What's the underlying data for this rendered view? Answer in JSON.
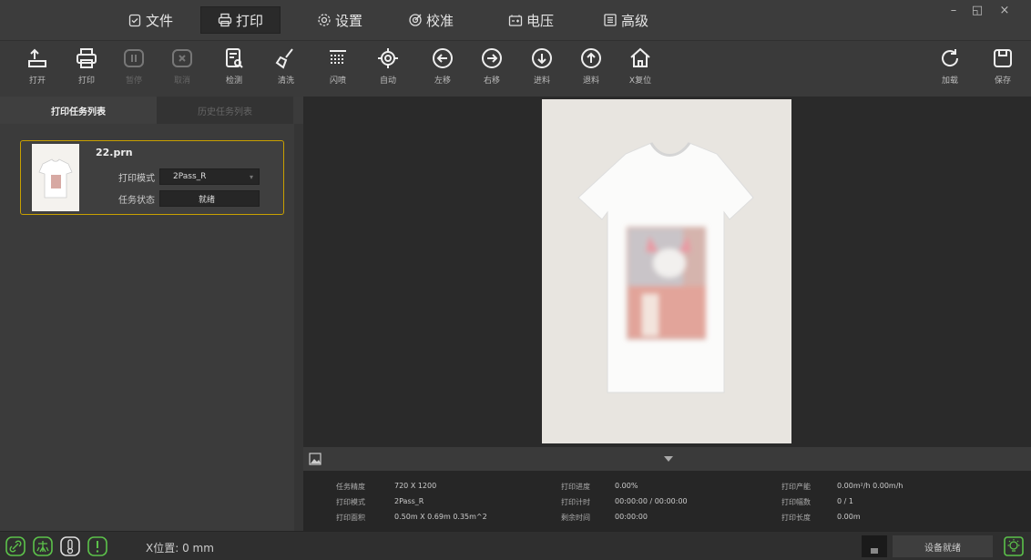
{
  "menu": {
    "file": "文件",
    "print": "打印",
    "settings": "设置",
    "calibrate": "校准",
    "voltage": "电压",
    "advanced": "高级"
  },
  "window": {
    "minimize": "–",
    "restore": "◱",
    "close": "×"
  },
  "toolbar": {
    "open": "打开",
    "print": "打印",
    "pause": "暂停",
    "cancel": "取消",
    "check": "检测",
    "clean": "清洗",
    "flash": "闪喷",
    "auto": "自动",
    "move_left": "左移",
    "move_right": "右移",
    "feed_in": "进料",
    "feed_out": "退料",
    "x_reset": "X复位",
    "load": "加载",
    "save": "保存"
  },
  "left_panel": {
    "tab_tasks": "打印任务列表",
    "tab_history": "历史任务列表",
    "job": {
      "name": "22.prn",
      "mode_label": "打印模式",
      "mode_value": "2Pass_R",
      "status_label": "任务状态",
      "status_value": "就绪"
    }
  },
  "info": {
    "resolution_label": "任务精度",
    "resolution_value": "720 X 1200",
    "mode_label": "打印模式",
    "mode_value": "2Pass_R",
    "area_label": "打印面积",
    "area_value": "0.50m X 0.69m  0.35m^2",
    "progress_label": "打印进度",
    "progress_value": "0.00%",
    "timer_label": "打印计时",
    "timer_value": "00:00:00 / 00:00:00",
    "remaining_label": "剩余时间",
    "remaining_value": "00:00:00",
    "output_label": "打印产能",
    "output_value": "0.00m²/h  0.00m/h",
    "copies_label": "打印幅数",
    "copies_value": "0 / 1",
    "length_label": "打印长度",
    "length_value": "0.00m"
  },
  "status": {
    "xpos": "X位置: 0 mm",
    "device_ready": "设备就绪"
  },
  "colors": {
    "accent_green": "#5cc24a",
    "job_border": "#c8a000"
  }
}
